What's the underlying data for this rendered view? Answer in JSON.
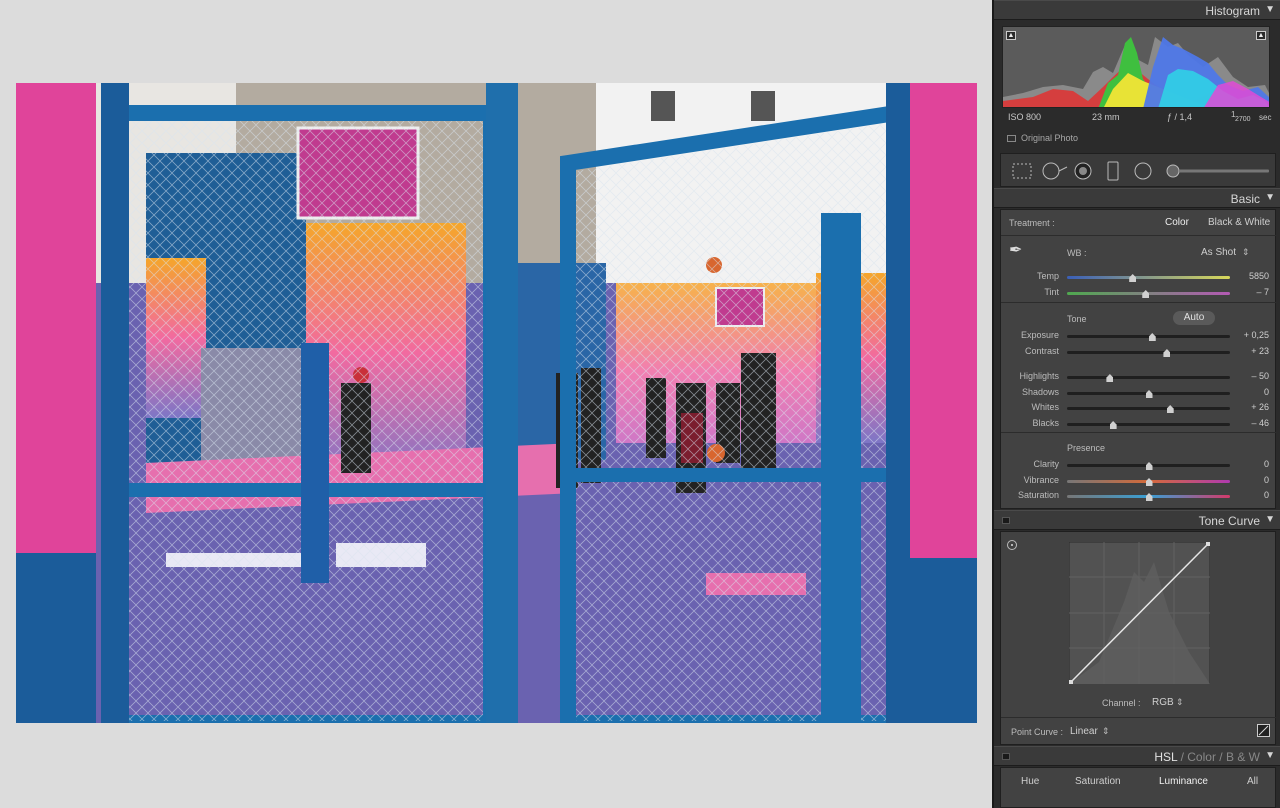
{
  "photo": {
    "description_alt": "Fenced basketball court with gates"
  },
  "panels": {
    "histogram": {
      "title": "Histogram",
      "exif": {
        "iso": "ISO 800",
        "focal": "23 mm",
        "aperture": "ƒ / 1,4",
        "shutter_num": "1",
        "shutter_den": "2700",
        "shutter_unit": "sec"
      },
      "original_photo": "Original Photo"
    },
    "basic": {
      "title": "Basic",
      "treatment_label": "Treatment :",
      "treatment_color": "Color",
      "treatment_bw": "Black & White",
      "wb_label": "WB :",
      "wb_value": "As Shot",
      "tone_label": "Tone",
      "auto_label": "Auto",
      "presence_label": "Presence",
      "sliders": [
        {
          "label": "Temp",
          "value": "5850",
          "pos": 0.4
        },
        {
          "label": "Tint",
          "value": "– 7",
          "pos": 0.48
        },
        {
          "label": "Exposure",
          "value": "+ 0,25",
          "pos": 0.52
        },
        {
          "label": "Contrast",
          "value": "+ 23",
          "pos": 0.61
        },
        {
          "label": "Highlights",
          "value": "– 50",
          "pos": 0.26
        },
        {
          "label": "Shadows",
          "value": "0",
          "pos": 0.5
        },
        {
          "label": "Whites",
          "value": "+ 26",
          "pos": 0.63
        },
        {
          "label": "Blacks",
          "value": "– 46",
          "pos": 0.28
        },
        {
          "label": "Clarity",
          "value": "0",
          "pos": 0.5
        },
        {
          "label": "Vibrance",
          "value": "0",
          "pos": 0.5
        },
        {
          "label": "Saturation",
          "value": "0",
          "pos": 0.5
        }
      ]
    },
    "tone_curve": {
      "title": "Tone Curve",
      "channel_label": "Channel :",
      "channel_value": "RGB",
      "point_curve_label": "Point Curve :",
      "point_curve_value": "Linear"
    },
    "hsl": {
      "title_hsl": "HSL",
      "title_color": "Color",
      "title_bw": "B & W",
      "slash": "/",
      "tabs": [
        "Hue",
        "Saturation",
        "Luminance",
        "All"
      ]
    }
  },
  "colors": {
    "accent_pink": "#e0449a",
    "gate_blue": "#1b6fae",
    "court_purple": "#6a62b0"
  }
}
